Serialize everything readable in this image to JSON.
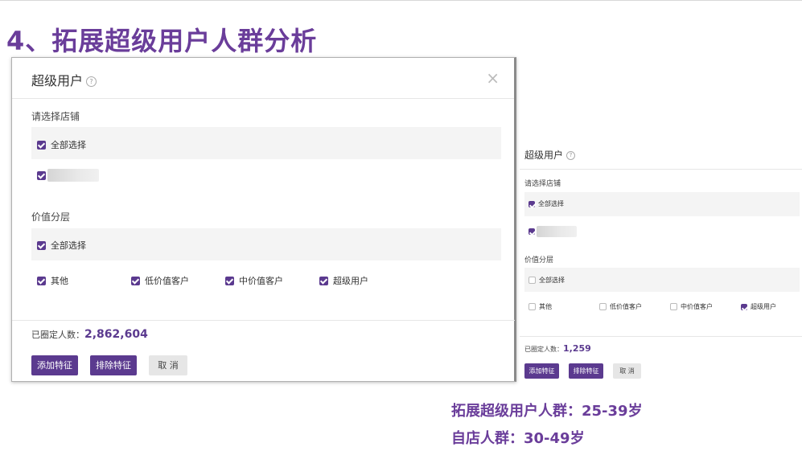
{
  "slide": {
    "title": "4、拓展超级用户人群分析",
    "notes": [
      "拓展超级用户人群：25-39岁",
      "自店人群：30-49岁"
    ]
  },
  "modal_left": {
    "title": "超级用户",
    "help_icon": "question-circle-icon",
    "close_icon": "close-icon",
    "store_section_label": "请选择店铺",
    "store_select_all": "全部选择",
    "store_select_all_checked": true,
    "store_item_checked": true,
    "tier_section_label": "价值分层",
    "tier_select_all": "全部选择",
    "tier_select_all_checked": true,
    "tiers": [
      {
        "label": "其他",
        "checked": true
      },
      {
        "label": "低价值客户",
        "checked": true
      },
      {
        "label": "中价值客户",
        "checked": true
      },
      {
        "label": "超级用户",
        "checked": true
      }
    ],
    "count_label": "已圈定人数：",
    "count_value": "2,862,604",
    "buttons": {
      "add": "添加特征",
      "exclude": "排除特征",
      "cancel": "取 消"
    }
  },
  "modal_right": {
    "title": "超级用户",
    "store_section_label": "请选择店铺",
    "store_select_all": "全部选择",
    "store_select_all_checked": true,
    "store_item_checked": true,
    "tier_section_label": "价值分层",
    "tier_select_all": "全部选择",
    "tier_select_all_checked": false,
    "tiers": [
      {
        "label": "其他",
        "checked": false
      },
      {
        "label": "低价值客户",
        "checked": false
      },
      {
        "label": "中价值客户",
        "checked": false
      },
      {
        "label": "超级用户",
        "checked": true
      }
    ],
    "count_label": "已圈定人数：",
    "count_value": "1,259",
    "buttons": {
      "add": "添加特征",
      "exclude": "排除特征",
      "cancel": "取 消"
    }
  },
  "colors": {
    "accent": "#5b3a8f",
    "title": "#6a3d9a",
    "panel_bg": "#f4f4f4"
  }
}
